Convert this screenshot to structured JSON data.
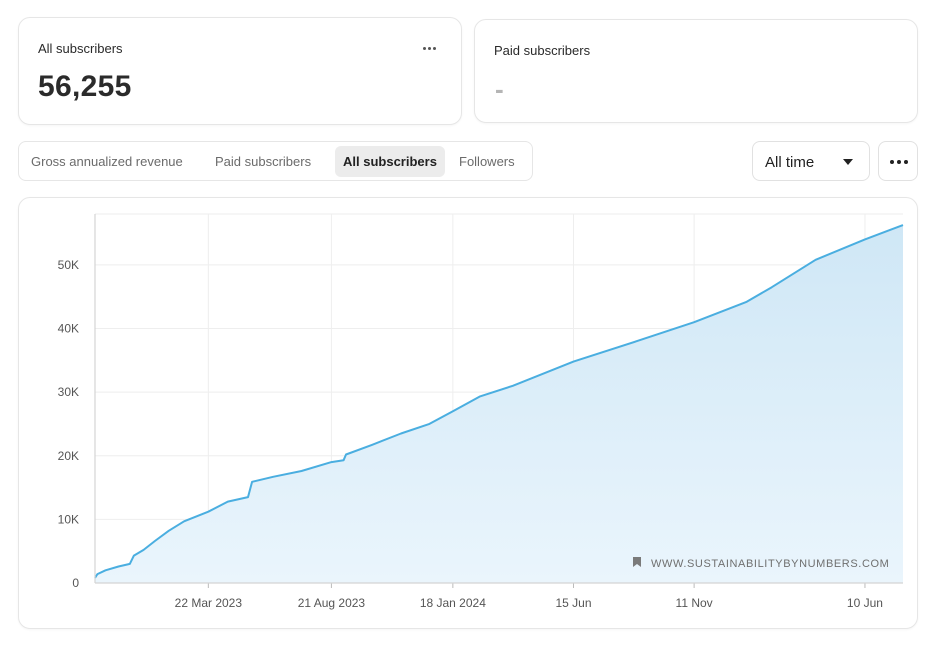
{
  "cards": {
    "all_subscribers": {
      "label": "All subscribers",
      "value": "56,255"
    },
    "paid_subscribers": {
      "label": "Paid subscribers",
      "value": "-"
    }
  },
  "tabs": [
    {
      "label": "Gross annualized revenue",
      "active": false
    },
    {
      "label": "Paid subscribers",
      "active": false
    },
    {
      "label": "All subscribers",
      "active": true
    },
    {
      "label": "Followers",
      "active": false
    }
  ],
  "range_select": {
    "label": "All time"
  },
  "colors": {
    "line": "#4aaee0",
    "fill_top": "#cfe7f6",
    "fill_bottom": "#eaf5fc",
    "grid": "#eeeeee"
  },
  "icons": {
    "card_menu": "more-horizontal-icon",
    "more_button": "more-horizontal-icon",
    "watermark": "bookmark-icon",
    "select_caret": "caret-down-icon"
  },
  "chart_data": {
    "type": "area",
    "xlabel": "",
    "ylabel": "",
    "ylim": [
      0,
      58000
    ],
    "y_ticks": [
      0,
      10000,
      20000,
      30000,
      40000,
      50000
    ],
    "y_tick_labels": [
      "0",
      "10K",
      "20K",
      "30K",
      "40K",
      "50K"
    ],
    "x_tick_labels": [
      "22 Mar 2023",
      "21 Aug 2023",
      "18 Jan 2024",
      "15 Jun",
      "11 Nov",
      "10 Jun"
    ],
    "x_start": "2022-11-02",
    "x_end": "2025-07-27",
    "x_ticks": [
      "2023-03-22",
      "2023-08-21",
      "2024-01-18",
      "2024-06-15",
      "2024-11-11",
      "2025-06-10"
    ],
    "grid": true,
    "watermark": "WWW.SUSTAINABILITYBYNUMBERS.COM",
    "series": [
      {
        "values": [
          [
            "2022-11-02",
            800
          ],
          [
            "2022-11-05",
            1400
          ],
          [
            "2022-11-15",
            2000
          ],
          [
            "2022-12-01",
            2600
          ],
          [
            "2022-12-15",
            3000
          ],
          [
            "2022-12-20",
            4300
          ],
          [
            "2023-01-01",
            5200
          ],
          [
            "2023-01-15",
            6600
          ],
          [
            "2023-02-01",
            8200
          ],
          [
            "2023-02-20",
            9700
          ],
          [
            "2023-03-22",
            11200
          ],
          [
            "2023-04-15",
            12800
          ],
          [
            "2023-05-10",
            13500
          ],
          [
            "2023-05-15",
            15900
          ],
          [
            "2023-06-10",
            16700
          ],
          [
            "2023-07-15",
            17600
          ],
          [
            "2023-08-21",
            19000
          ],
          [
            "2023-09-05",
            19300
          ],
          [
            "2023-09-08",
            20200
          ],
          [
            "2023-10-10",
            21700
          ],
          [
            "2023-11-15",
            23500
          ],
          [
            "2023-12-20",
            25000
          ],
          [
            "2024-01-18",
            27000
          ],
          [
            "2024-02-20",
            29300
          ],
          [
            "2024-04-01",
            31000
          ],
          [
            "2024-06-15",
            34800
          ],
          [
            "2024-09-01",
            38000
          ],
          [
            "2024-11-11",
            41000
          ],
          [
            "2025-01-15",
            44200
          ],
          [
            "2025-02-15",
            46500
          ],
          [
            "2025-04-10",
            50800
          ],
          [
            "2025-06-10",
            54000
          ],
          [
            "2025-07-27",
            56255
          ]
        ]
      }
    ]
  }
}
